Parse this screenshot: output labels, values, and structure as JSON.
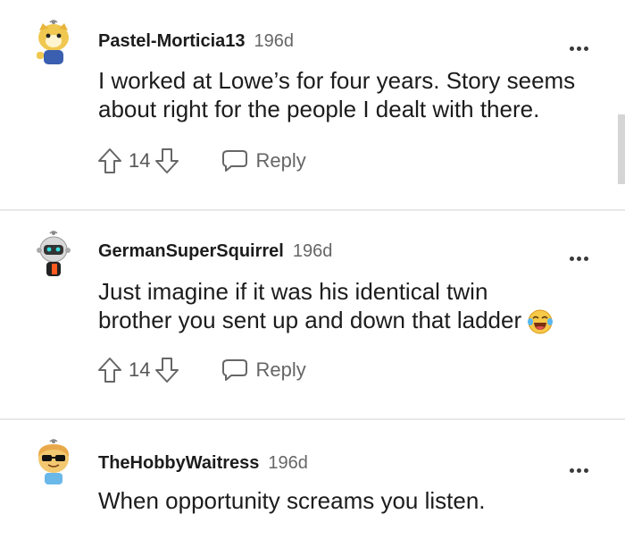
{
  "comments": [
    {
      "username": "Pastel-Morticia13",
      "age": "196d",
      "lines": [
        "I worked at Lowe’s for four years. Story seems",
        "about right for the people I dealt with there."
      ],
      "score": "14",
      "reply_label": "Reply"
    },
    {
      "username": "GermanSuperSquirrel",
      "age": "196d",
      "lines": [
        "Just imagine if it was his identical twin",
        "brother you sent up and down that ladder"
      ],
      "score": "14",
      "reply_label": "Reply"
    },
    {
      "username": "TheHobbyWaitress",
      "age": "196d",
      "lines": [
        "When opportunity screams you listen."
      ]
    }
  ],
  "icons": {
    "upvote": "arrow-up-icon",
    "downvote": "arrow-down-icon",
    "reply": "speech-bubble-icon",
    "more": "more-options-icon",
    "emoji": "laughing-tears-emoji"
  },
  "colors": {
    "text": "#1c1c1c",
    "muted": "#666666",
    "divider": "#e8e8e8"
  }
}
